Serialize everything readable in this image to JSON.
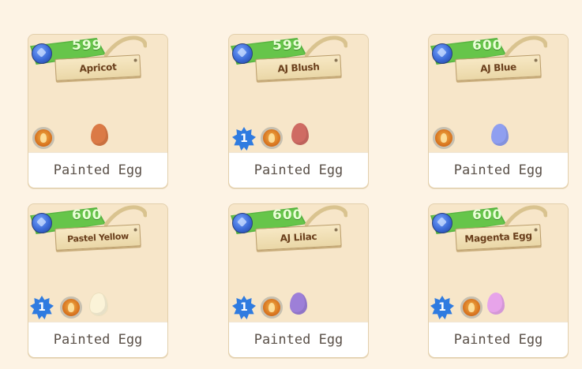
{
  "items": [
    {
      "price": "599",
      "name": "Apricot",
      "owned_count": "",
      "egg_color": "#db7a46",
      "caption": "Painted Egg"
    },
    {
      "price": "599",
      "name": "AJ Blush",
      "owned_count": "1",
      "egg_color": "#cf6b63",
      "caption": "Painted Egg"
    },
    {
      "price": "600",
      "name": "AJ Blue",
      "owned_count": "",
      "egg_color": "#8f9ff0",
      "caption": "Painted Egg"
    },
    {
      "price": "600",
      "name": "Pastel Yellow",
      "owned_count": "1",
      "egg_color": "#fbf3d8",
      "caption": "Painted Egg"
    },
    {
      "price": "600",
      "name": "AJ Lilac",
      "owned_count": "1",
      "egg_color": "#9d7fd8",
      "caption": "Painted Egg"
    },
    {
      "price": "600",
      "name": "Magenta Egg",
      "owned_count": "1",
      "egg_color": "#e7a4ea",
      "caption": "Painted Egg"
    }
  ],
  "icons": {
    "currency": "gem-icon",
    "clan": "clan-emblem-icon",
    "badge": "owned-count-badge"
  }
}
